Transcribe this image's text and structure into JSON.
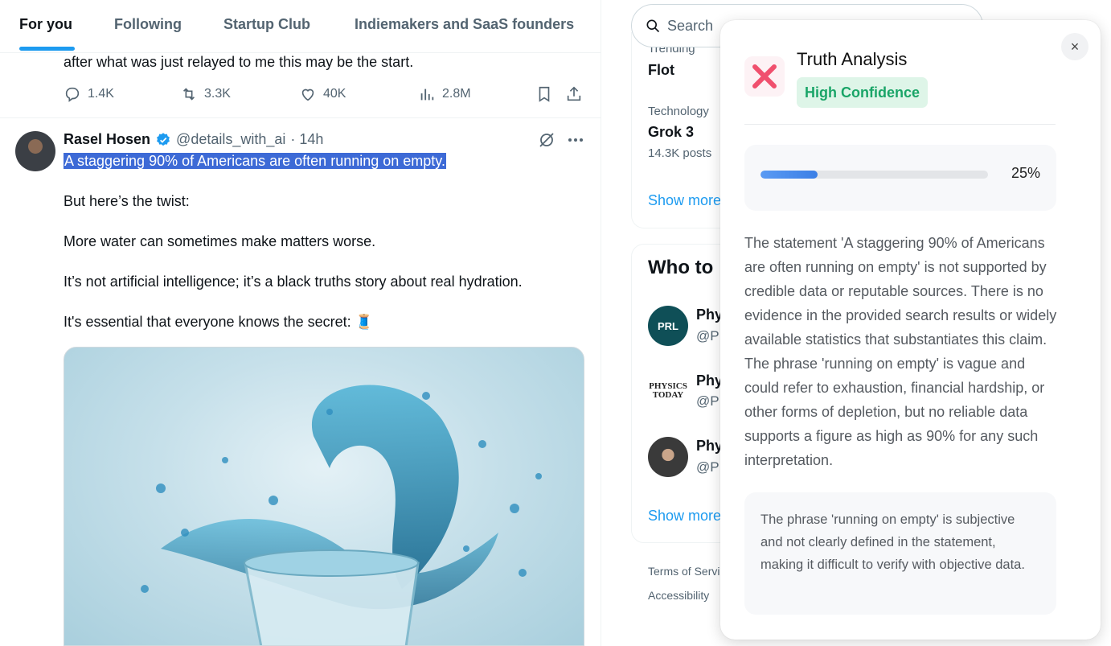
{
  "tabs": [
    {
      "label": "For you",
      "active": true
    },
    {
      "label": "Following",
      "active": false
    },
    {
      "label": "Startup Club",
      "active": false
    },
    {
      "label": "Indiemakers and SaaS founders",
      "active": false
    }
  ],
  "previous_tweet": {
    "text_tail": "after what was just relayed to me this may be the start.",
    "replies": "1.4K",
    "reposts": "3.3K",
    "likes": "40K",
    "views": "2.8M"
  },
  "tweet": {
    "author_name": "Rasel Hosen",
    "handle": "@details_with_ai",
    "time": "· 14h",
    "highlighted_line": "A staggering 90% of Americans are often running on empty.",
    "lines": [
      "But here’s the twist:",
      "More water can sometimes make matters worse.",
      "It’s not artificial intelligence; it’s a black truths story about real hydration.",
      "It's essential that everyone knows the secret: 🧵"
    ]
  },
  "sidebar": {
    "search_placeholder": "Search",
    "trend_1_context": "Trending",
    "trend_1_name": "Flot",
    "trend_2_context": "Technology",
    "trend_2_name": "Grok 3",
    "trend_2_posts": "14.3K posts",
    "show_more": "Show more",
    "who_to_follow_title": "Who to",
    "follow": [
      {
        "name": "Phy",
        "handle": "@P",
        "avatar_text": "PRL"
      },
      {
        "name": "Phy",
        "handle": "@P",
        "avatar_text": "PHYSICS TODAY"
      },
      {
        "name": "Phy",
        "handle": "@P",
        "avatar_text": ""
      }
    ],
    "footer_1": "Terms of Servi",
    "footer_2": "Accessibility"
  },
  "truth_panel": {
    "title": "Truth Analysis",
    "confidence": "High Confidence",
    "verdict_icon": "cross-mark-icon",
    "score_percent": 25,
    "score_label": "25%",
    "analysis": "The statement 'A staggering 90% of Americans are often running on empty' is not supported by credible data or reputable sources. There is no evidence in the provided search results or widely available statistics that substantiates this claim. The phrase 'running on empty' is vague and could refer to exhaustion, financial hardship, or other forms of depletion, but no reliable data supports a figure as high as 90% for any such interpretation.",
    "note": "The phrase 'running on empty' is subjective and not clearly defined in the statement, making it difficult to verify with objective data.",
    "close_label": "×",
    "colors": {
      "accent": "#3b7fe6",
      "confidence_bg": "#def5e8",
      "confidence_text": "#1aa568",
      "verdict": "#f0506e"
    }
  }
}
